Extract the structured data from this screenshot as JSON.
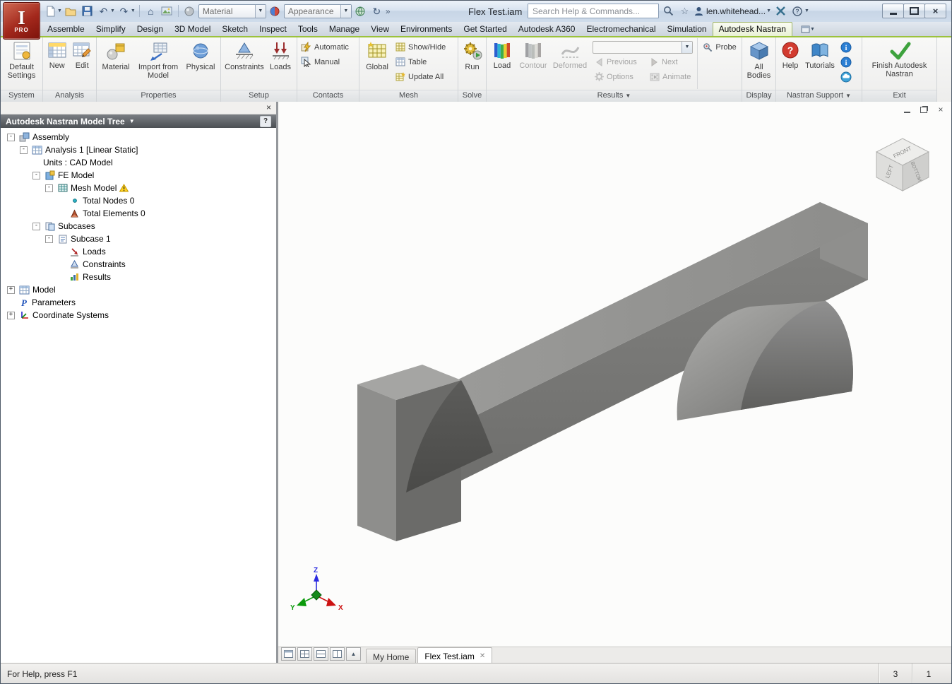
{
  "colors": {
    "active_tab_green": "#9cc23c",
    "warning_yellow": "#ffd21e",
    "model_gray": "#8a8a8a",
    "panel_header_gray": "#55585c"
  },
  "titlebar": {
    "app_badge": "PRO",
    "doc_title": "Flex Test.iam",
    "material_combo": "Material",
    "appearance_combo": "Appearance",
    "search_placeholder": "Search Help & Commands...",
    "user_name": "len.whitehead..."
  },
  "ribbon": {
    "tabs": [
      {
        "label": "Assemble"
      },
      {
        "label": "Simplify"
      },
      {
        "label": "Design"
      },
      {
        "label": "3D Model"
      },
      {
        "label": "Sketch"
      },
      {
        "label": "Inspect"
      },
      {
        "label": "Tools"
      },
      {
        "label": "Manage"
      },
      {
        "label": "View"
      },
      {
        "label": "Environments"
      },
      {
        "label": "Get Started"
      },
      {
        "label": "Autodesk A360"
      },
      {
        "label": "Electromechanical"
      },
      {
        "label": "Simulation"
      },
      {
        "label": "Autodesk Nastran",
        "active": true
      }
    ],
    "groups": {
      "system": {
        "label": "System",
        "default_settings": "Default Settings"
      },
      "analysis": {
        "label": "Analysis",
        "new": "New",
        "edit": "Edit"
      },
      "properties": {
        "label": "Properties",
        "material": "Material",
        "import_from_model": "Import from Model",
        "physical": "Physical"
      },
      "setup": {
        "label": "Setup",
        "constraints": "Constraints",
        "loads": "Loads"
      },
      "contacts": {
        "label": "Contacts",
        "automatic": "Automatic",
        "manual": "Manual"
      },
      "mesh": {
        "label": "Mesh",
        "global": "Global",
        "show_hide": "Show/Hide",
        "table": "Table",
        "update_all": "Update All"
      },
      "solve": {
        "label": "Solve",
        "run": "Run"
      },
      "results": {
        "label": "Results",
        "load": "Load",
        "contour": "Contour",
        "deformed": "Deformed",
        "previous": "Previous",
        "next": "Next",
        "options": "Options",
        "animate": "Animate",
        "probe": "Probe",
        "result_set_value": "",
        "disabled_buttons": [
          "Contour",
          "Deformed",
          "Previous",
          "Next",
          "Options",
          "Animate"
        ]
      },
      "display": {
        "label": "Display",
        "all_bodies": "All Bodies"
      },
      "nastran_support": {
        "label": "Nastran Support",
        "help": "Help",
        "tutorials": "Tutorials"
      },
      "exit": {
        "label": "Exit",
        "finish": "Finish Autodesk Nastran"
      }
    }
  },
  "model_tree": {
    "header": "Autodesk Nastran Model Tree",
    "items": [
      {
        "label": "Assembly",
        "level": 0,
        "state": "expanded"
      },
      {
        "label": "Analysis 1 [Linear Static]",
        "level": 1,
        "state": "expanded"
      },
      {
        "label": "Units : CAD Model",
        "level": 2
      },
      {
        "label": "FE Model",
        "level": 2,
        "state": "expanded"
      },
      {
        "label": "Mesh Model",
        "level": 3,
        "state": "expanded",
        "warning": true
      },
      {
        "label": "Total Nodes 0",
        "level": 4
      },
      {
        "label": "Total Elements 0",
        "level": 4
      },
      {
        "label": "Subcases",
        "level": 2,
        "state": "expanded"
      },
      {
        "label": "Subcase 1",
        "level": 3,
        "state": "expanded"
      },
      {
        "label": "Loads",
        "level": 4
      },
      {
        "label": "Constraints",
        "level": 4
      },
      {
        "label": "Results",
        "level": 4
      },
      {
        "label": "Model",
        "level": 0,
        "state": "collapsed"
      },
      {
        "label": "Parameters",
        "level": 0
      },
      {
        "label": "Coordinate Systems",
        "level": 0,
        "state": "collapsed"
      }
    ]
  },
  "viewport": {
    "viewcube": {
      "top_face": "FRONT",
      "left_face": "LEFT",
      "right_face": "BOTTOM"
    },
    "triad": {
      "x": "X",
      "y": "Y",
      "z": "Z"
    },
    "doc_tabs": [
      {
        "label": "My Home"
      },
      {
        "label": "Flex Test.iam",
        "active": true
      }
    ]
  },
  "status_bar": {
    "message": "For Help, press F1",
    "cells": [
      "3",
      "1"
    ]
  }
}
